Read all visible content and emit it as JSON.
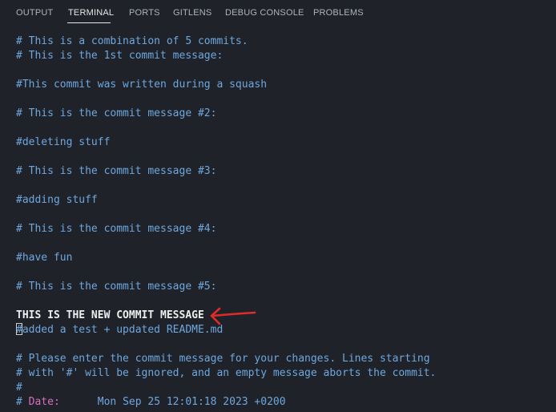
{
  "tabs": [
    {
      "label": "OUTPUT"
    },
    {
      "label": "TERMINAL"
    },
    {
      "label": "PORTS"
    },
    {
      "label": "GITLENS"
    },
    {
      "label": "DEBUG CONSOLE"
    },
    {
      "label": "PROBLEMS"
    }
  ],
  "active_tab": "TERMINAL",
  "terminal": {
    "lines": [
      "# This is a combination of 5 commits.",
      "# This is the 1st commit message:",
      "#This commit was written during a squash",
      "# This is the commit message #2:",
      "#deleting stuff",
      "# This is the commit message #3:",
      "#adding stuff",
      "# This is the commit message #4:",
      "#have fun",
      "# This is the commit message #5:",
      "THIS IS THE NEW COMMIT MESSAGE",
      "#added a test + updated README.md",
      "# Please enter the commit message for your changes. Lines starting",
      "# with '#' will be ignored, and an empty message aborts the commit.",
      "#"
    ],
    "date_line": {
      "prefix": "# ",
      "key": "Date:",
      "value": "      Mon Sep 25 12:01:18 2023 +0200"
    }
  },
  "colors": {
    "background": "#1f2329",
    "comment_text": "#6ea7df",
    "new_message": "#eeeeee",
    "date_key": "#d66fbf",
    "arrow": "#e02b2b"
  },
  "annotation": {
    "icon": "red-arrow-icon"
  }
}
